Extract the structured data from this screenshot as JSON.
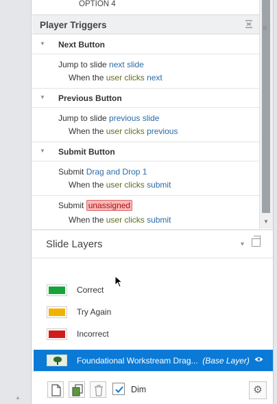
{
  "triggers_panel": {
    "prev_option": "OPTION 4",
    "section_title": "Player Triggers",
    "groups": [
      {
        "title": "Next Button",
        "triggers": [
          {
            "action": "Jump to slide",
            "target": "next slide",
            "when": "When the",
            "who": "user clicks",
            "what": "next"
          }
        ]
      },
      {
        "title": "Previous Button",
        "triggers": [
          {
            "action": "Jump to slide",
            "target": "previous slide",
            "when": "When the",
            "who": "user clicks",
            "what": "previous"
          }
        ]
      },
      {
        "title": "Submit Button",
        "triggers": [
          {
            "action": "Submit",
            "target": "Drag and Drop 1",
            "when": "When the",
            "who": "user clicks",
            "what": "submit"
          },
          {
            "action": "Submit",
            "target": "unassigned",
            "when": "When the",
            "who": "user clicks",
            "what": "submit"
          }
        ]
      }
    ]
  },
  "slide_layers": {
    "title": "Slide Layers",
    "layers": [
      {
        "label": "Correct",
        "color": "#18a33a"
      },
      {
        "label": "Try Again",
        "color": "#f0b400"
      },
      {
        "label": "Incorrect",
        "color": "#d21c1c"
      }
    ],
    "base_layer": {
      "label": "Foundational Workstream Drag...",
      "tag": "(Base Layer)"
    },
    "footer": {
      "dim_label": "Dim",
      "dim_checked": true
    }
  },
  "colors": {
    "accent": "#0b7ad6",
    "link": "#2a6aa8",
    "badge_bg": "#f7b9b9"
  }
}
